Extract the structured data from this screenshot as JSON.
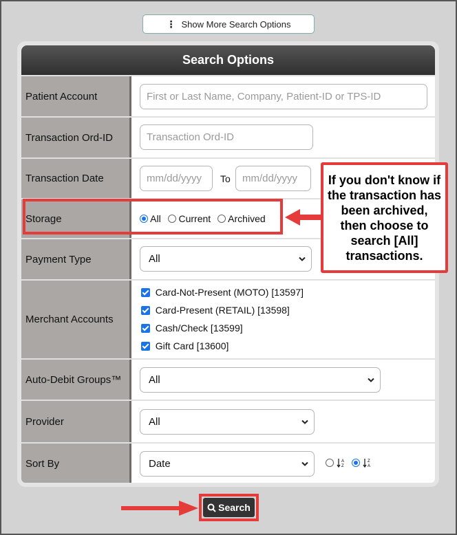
{
  "top_button": {
    "label": "Show More Search Options"
  },
  "panel": {
    "title": "Search Options"
  },
  "patient_account": {
    "label": "Patient Account",
    "placeholder": "First or Last Name, Company, Patient-ID or TPS-ID"
  },
  "transaction_ord_id": {
    "label": "Transaction Ord-ID",
    "placeholder": "Transaction Ord-ID"
  },
  "transaction_date": {
    "label": "Transaction Date",
    "from_placeholder": "mm/dd/yyyy",
    "to_label": "To",
    "to_placeholder": "mm/dd/yyyy"
  },
  "storage": {
    "label": "Storage",
    "options": [
      "All",
      "Current",
      "Archived"
    ],
    "selected": "All"
  },
  "payment_type": {
    "label": "Payment Type",
    "value": "All"
  },
  "merchant_accounts": {
    "label": "Merchant Accounts",
    "items": [
      "Card-Not-Present (MOTO) [13597]",
      "Card-Present (RETAIL) [13598]",
      "Cash/Check [13599]",
      "Gift Card [13600]"
    ]
  },
  "auto_debit_groups": {
    "label": "Auto-Debit Groups™",
    "value": "All"
  },
  "provider": {
    "label": "Provider",
    "value": "All"
  },
  "sort_by": {
    "label": "Sort By",
    "value": "Date",
    "asc_glyph": "↓A\nZ",
    "desc_glyph": "↓Z\nA"
  },
  "callout": {
    "text": "If you don't know if the transaction has been archived, then choose to search [All] transactions."
  },
  "search_button": {
    "label": "Search"
  },
  "colors": {
    "accent_red": "#e53b3b",
    "checkbox_blue": "#1a73e8",
    "header_dark": "#3a3a3a"
  }
}
